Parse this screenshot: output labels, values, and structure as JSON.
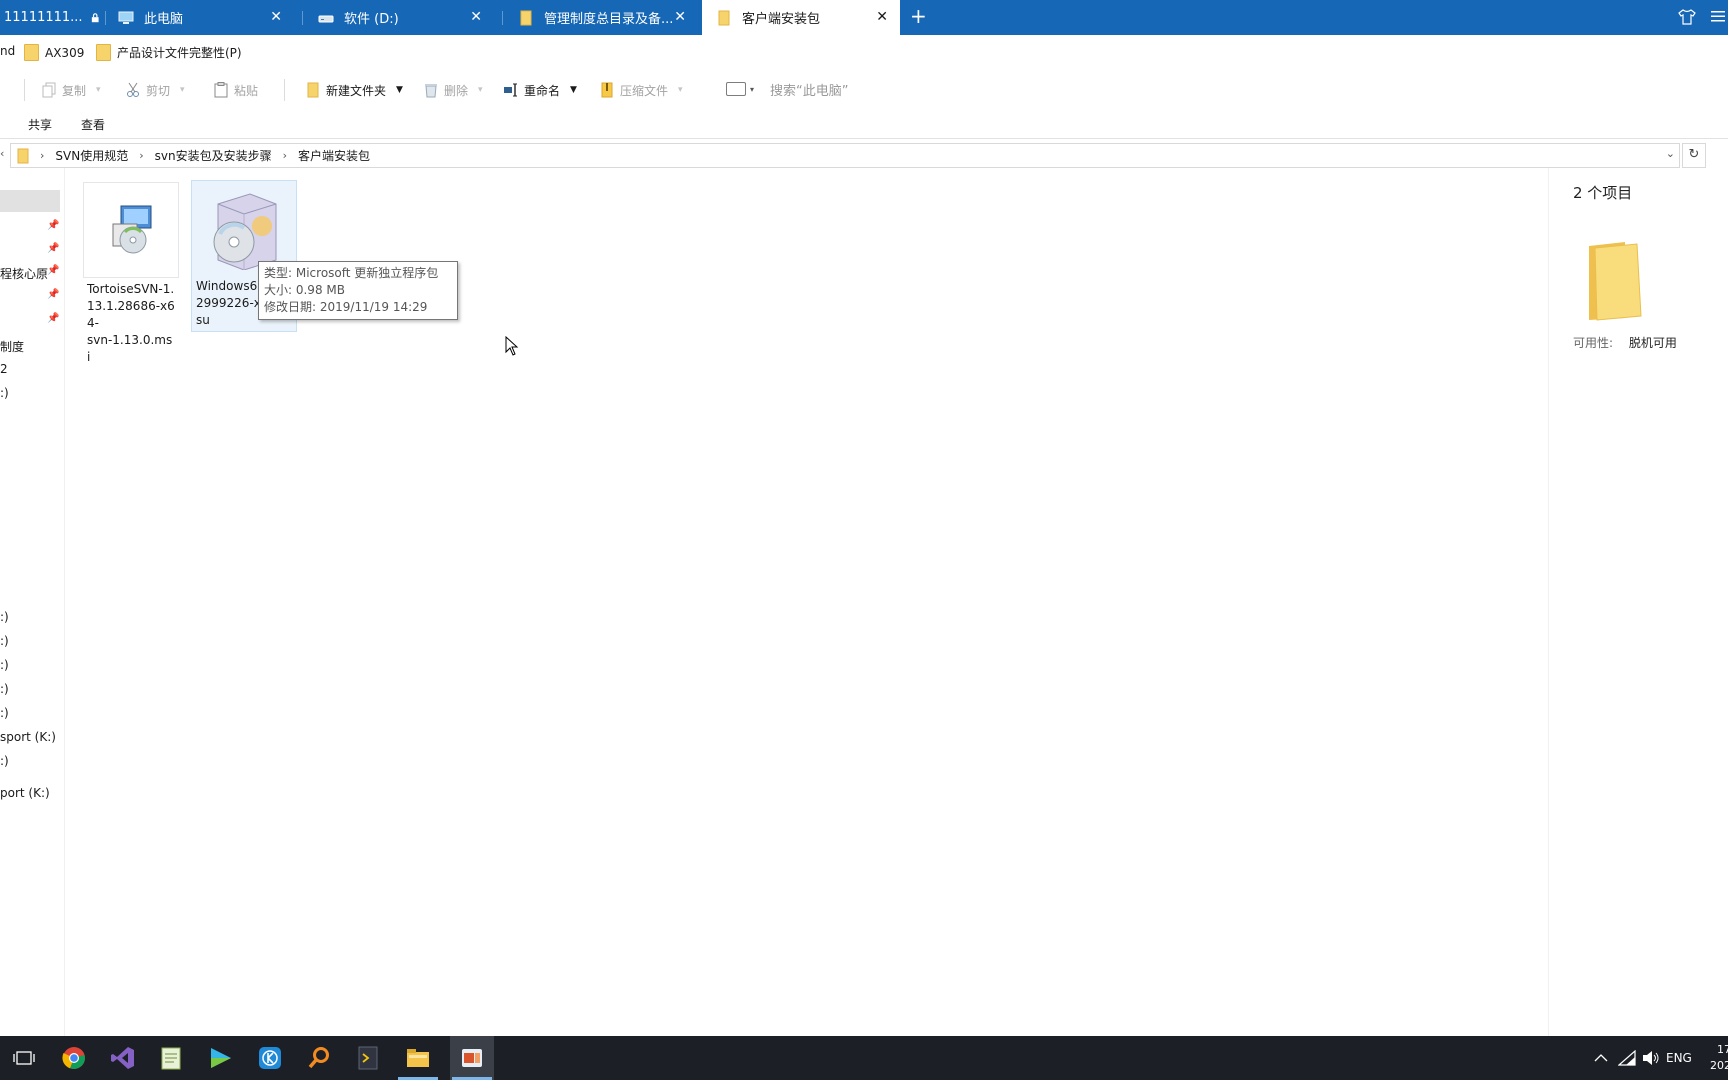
{
  "tabs": [
    {
      "label": "11111111...",
      "icon": "lock-icon",
      "active": false
    },
    {
      "label": "此电脑",
      "icon": "computer-icon",
      "active": false
    },
    {
      "label": "软件 (D:)",
      "icon": "drive-icon",
      "active": false
    },
    {
      "label": "管理制度总目录及备...",
      "icon": "folder-icon",
      "active": false
    },
    {
      "label": "客户端安装包",
      "icon": "folder-icon",
      "active": true
    }
  ],
  "tabbar": {
    "new_tab": "+",
    "close": "✕"
  },
  "bookmarks": [
    {
      "label": "nd"
    },
    {
      "label": "AX309"
    },
    {
      "label": "产品设计文件完整性(P)"
    }
  ],
  "toolbar": {
    "copy": "复制",
    "cut": "剪切",
    "paste": "粘贴",
    "new_folder": "新建文件夹",
    "delete": "删除",
    "rename": "重命名",
    "compress": "压缩文件",
    "search_placeholder": "搜索“此电脑”"
  },
  "menu": {
    "share": "共享",
    "view": "查看"
  },
  "breadcrumb": [
    "SVN使用规范",
    "svn安装包及安装步骤",
    "客户端安装包"
  ],
  "nav": {
    "items": [
      "程核心原",
      "制度",
      "2",
      ":)",
      ":)",
      ":)",
      ":)",
      ":)",
      ":)",
      "sport (K:)",
      ":)",
      "port (K:)"
    ]
  },
  "files": [
    {
      "name": "TortoiseSVN-1.13.1.28686-x64-svn-1.13.0.msi",
      "line1": "TortoiseSVN-1.",
      "line2": "13.1.28686-x64-",
      "line3": "svn-1.13.0.msi"
    },
    {
      "name": "Windows6...2999226-x...su",
      "line1": "Windows6",
      "line2": "2999226-x",
      "line3": "su"
    }
  ],
  "tooltip": {
    "type": "类型: Microsoft 更新独立程序包",
    "size": "大小: 0.98 MB",
    "modified": "修改日期: 2019/11/19 14:29"
  },
  "details": {
    "count": "2 个项目",
    "availability_label": "可用性:",
    "availability_value": "脱机可用"
  },
  "tray": {
    "lang": "ENG",
    "time": "17",
    "date": "202"
  },
  "colors": {
    "tabbar": "#1667b5",
    "taskbar": "#1c1f25",
    "folder": "#f7d36b"
  }
}
